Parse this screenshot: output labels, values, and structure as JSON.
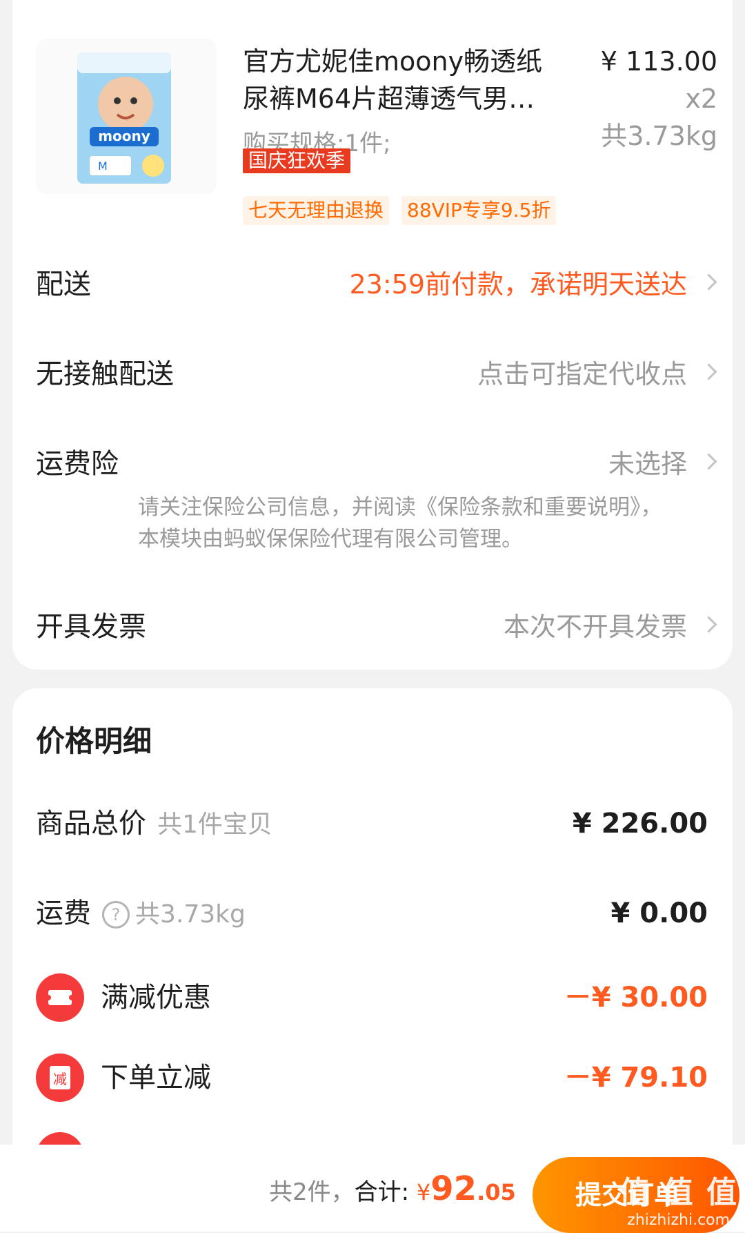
{
  "product": {
    "title": "官方尤妮佳moony畅透纸尿裤M64片超薄透气男…",
    "spec": "购买规格:1件;",
    "unit_price": "¥ 113.00",
    "quantity": "x2",
    "weight": "共3.73kg",
    "promo_badge": "国庆狂欢季",
    "tags": [
      "七天无理由退换",
      "88VIP专享9.5折"
    ],
    "image_brand_text": "moony"
  },
  "options": [
    {
      "label": "配送",
      "value": "23:59前付款，承诺明天送达"
    },
    {
      "label": "无接触配送",
      "value": "点击可指定代收点"
    },
    {
      "label": "运费险",
      "value": "未选择"
    },
    {
      "label": "开具发票",
      "value": "本次不开具发票"
    }
  ],
  "insurance_note": "请关注保险公司信息，并阅读《保险条款和重要说明》，本模块由蚂蚁保保险代理有限公司管理。",
  "price_detail": {
    "title": "价格明细",
    "goods_total_label": "商品总价",
    "goods_total_sub": "共1件宝贝",
    "goods_total_amount": "¥ 226.00",
    "shipping_label": "运费",
    "shipping_help": "?",
    "shipping_sub": "共3.73kg",
    "shipping_amount": "¥ 0.00",
    "discounts": [
      {
        "label": "满减优惠",
        "amount": "－¥ 30.00",
        "icon": "ticket-icon"
      },
      {
        "label": "下单立减",
        "amount": "－¥ 79.10",
        "icon": "jian-icon",
        "icon_text": "减"
      }
    ]
  },
  "bottom_bar": {
    "count_text": "共2件，",
    "total_label": "合计:",
    "currency": "¥",
    "total_int": "92",
    "total_dec": ".05",
    "submit_label": "提交订单"
  },
  "watermark": {
    "main": "值 值 值",
    "sub": "zhizhizhi.com"
  },
  "colors": {
    "accent": "#ff5a1f",
    "badge_red": "#e83a1f",
    "icon_red": "#f43a3a",
    "tag_bg": "#fff2e6"
  }
}
